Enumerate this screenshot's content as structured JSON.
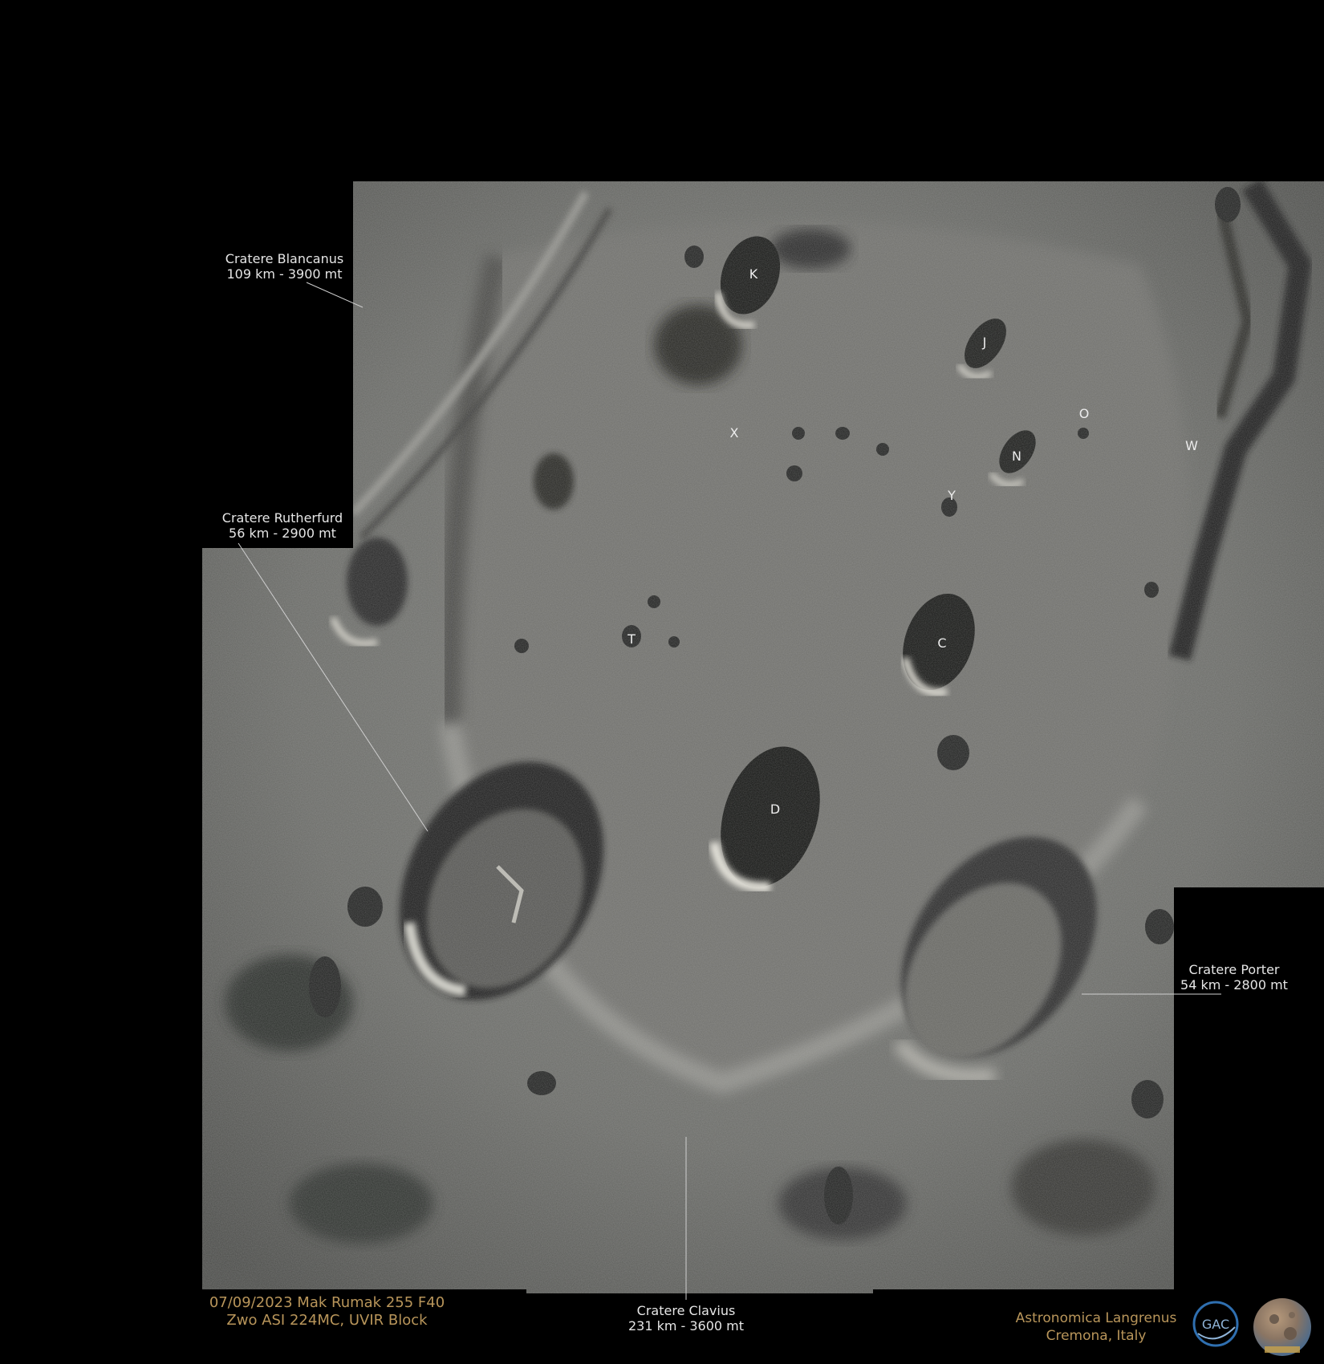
{
  "image": {
    "subject": "lunar-crater-region",
    "background_color": "#000000"
  },
  "labels": {
    "blancanus": {
      "name": "Cratere Blancanus",
      "size": "109 km - 3900 mt"
    },
    "rutherfurd": {
      "name": "Cratere Rutherfurd",
      "size": "56 km - 2900 mt"
    },
    "porter": {
      "name": "Cratere Porter",
      "size": "54 km - 2800 mt"
    },
    "clavius": {
      "name": "Cratere Clavius",
      "size": "231 km - 3600 mt"
    }
  },
  "crater_letters": {
    "K": "K",
    "J": "J",
    "O": "O",
    "X": "X",
    "N": "N",
    "W": "W",
    "Y": "Y",
    "T": "T",
    "C": "C",
    "D": "D"
  },
  "credits": {
    "equipment_line1": "07/09/2023 Mak Rumak 255 F40",
    "equipment_line2": "Zwo ASI 224MC, UVIR Block",
    "org_line1": "Astronomica Langrenus",
    "org_line2": "Cremona, Italy",
    "logo_text": "GAC",
    "text_color": "#b8955a"
  }
}
